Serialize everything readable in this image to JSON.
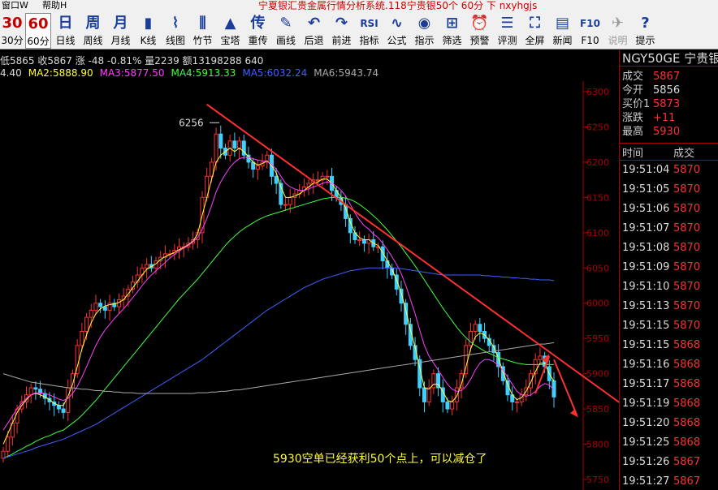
{
  "menu": {
    "window": "窗口W",
    "help": "帮助H"
  },
  "window_title": "宁夏银汇贵金属行情分析系统.118宁贵银50个 60分 下 nxyhgjs",
  "toolbar": [
    {
      "glyph": "30",
      "label": "30分",
      "disabled": false,
      "selected": false
    },
    {
      "glyph": "60",
      "label": "60分",
      "disabled": false,
      "selected": true
    },
    {
      "glyph": "日",
      "label": "日线",
      "disabled": false,
      "selected": false
    },
    {
      "glyph": "周",
      "label": "周线",
      "disabled": false,
      "selected": false
    },
    {
      "glyph": "月",
      "label": "月线",
      "disabled": false,
      "selected": false
    },
    {
      "glyph": "▮",
      "label": "K线",
      "disabled": false,
      "selected": false
    },
    {
      "glyph": "⌇",
      "label": "线图",
      "disabled": false,
      "selected": false
    },
    {
      "glyph": "⫼",
      "label": "竹节",
      "disabled": false,
      "selected": false
    },
    {
      "glyph": "▲",
      "label": "宝塔",
      "disabled": false,
      "selected": false
    },
    {
      "glyph": "传",
      "label": "重传",
      "disabled": false,
      "selected": false
    },
    {
      "glyph": "✎",
      "label": "画线",
      "disabled": false,
      "selected": false
    },
    {
      "glyph": "↶",
      "label": "后退",
      "disabled": false,
      "selected": false
    },
    {
      "glyph": "↷",
      "label": "前进",
      "disabled": false,
      "selected": false
    },
    {
      "glyph": "RSI",
      "label": "指标",
      "disabled": false,
      "selected": false
    },
    {
      "glyph": "∿",
      "label": "公式",
      "disabled": false,
      "selected": false
    },
    {
      "glyph": "◉",
      "label": "指示",
      "disabled": false,
      "selected": false
    },
    {
      "glyph": "⊞",
      "label": "筛选",
      "disabled": false,
      "selected": false
    },
    {
      "glyph": "⏰",
      "label": "预警",
      "disabled": false,
      "selected": false
    },
    {
      "glyph": "☰",
      "label": "评测",
      "disabled": false,
      "selected": false
    },
    {
      "glyph": "⛶",
      "label": "全屏",
      "disabled": false,
      "selected": false
    },
    {
      "glyph": "▤",
      "label": "新闻",
      "disabled": false,
      "selected": false
    },
    {
      "glyph": "F10",
      "label": "F10",
      "disabled": false,
      "selected": false
    },
    {
      "glyph": "✈",
      "label": "说明",
      "disabled": true,
      "selected": false
    },
    {
      "glyph": "?",
      "label": "提示",
      "disabled": false,
      "selected": false
    }
  ],
  "info_bar": "低5865 收5867 涨 -48 -0.81% 量2239 额13198288 640",
  "ma_values": [
    {
      "name": "MA1",
      "text": "4.40",
      "color": "#dddddd"
    },
    {
      "name": "MA2",
      "text": "MA2:5888.90",
      "color": "#ffff40"
    },
    {
      "name": "MA3",
      "text": "MA3:5877.50",
      "color": "#ff40ff"
    },
    {
      "name": "MA4",
      "text": "MA4:5913.33",
      "color": "#40ff40"
    },
    {
      "name": "MA5",
      "text": "MA5:6032.24",
      "color": "#4060ff"
    },
    {
      "name": "MA6",
      "text": "MA6:5943.74",
      "color": "#aaaaaa"
    }
  ],
  "right_panel": {
    "symbol": "NGY50GE 宁贵银",
    "quote": [
      {
        "key": "成交",
        "value": "5867"
      },
      {
        "key": "今开",
        "value": "5856",
        "neutral": true
      },
      {
        "key": "买价1",
        "value": "5873"
      },
      {
        "key": "涨跌",
        "value": "+11"
      },
      {
        "key": "最高",
        "value": "5930"
      }
    ],
    "tick_header": {
      "time": "时间",
      "price": "成交"
    },
    "ticks": [
      {
        "time": "19:51:04",
        "price": "5870"
      },
      {
        "time": "19:51:05",
        "price": "5870"
      },
      {
        "time": "19:51:06",
        "price": "5870"
      },
      {
        "time": "19:51:07",
        "price": "5870"
      },
      {
        "time": "19:51:08",
        "price": "5870"
      },
      {
        "time": "19:51:09",
        "price": "5870"
      },
      {
        "time": "19:51:10",
        "price": "5870"
      },
      {
        "time": "19:51:13",
        "price": "5870"
      },
      {
        "time": "19:51:15",
        "price": "5870"
      },
      {
        "time": "19:51:15",
        "price": "5868"
      },
      {
        "time": "19:51:16",
        "price": "5868"
      },
      {
        "time": "19:51:17",
        "price": "5868"
      },
      {
        "time": "19:51:19",
        "price": "5868"
      },
      {
        "time": "19:51:20",
        "price": "5868"
      },
      {
        "time": "19:51:25",
        "price": "5868"
      },
      {
        "time": "19:51:26",
        "price": "5867"
      },
      {
        "time": "19:51:27",
        "price": "5867"
      }
    ]
  },
  "colors": {
    "up": "#ff3030",
    "down": "#40d0ff",
    "axis": "#aa0000",
    "trend": "#ff3030"
  },
  "chart_data": {
    "type": "candlestick",
    "y_ticks": [
      6300,
      6250,
      6200,
      6150,
      6100,
      6050,
      6000,
      5950,
      5900,
      5850,
      5800,
      5750
    ],
    "ylim": [
      5735,
      6315
    ],
    "peak_label": "6256",
    "annotation": "5930空单已经获利50个点上，可以减仓了",
    "closes": [
      5790,
      5810,
      5830,
      5850,
      5860,
      5870,
      5880,
      5878,
      5872,
      5865,
      5860,
      5855,
      5850,
      5845,
      5880,
      5900,
      5940,
      5960,
      5980,
      5990,
      6000,
      5995,
      5990,
      6000,
      5995,
      6005,
      6010,
      6020,
      6030,
      6040,
      6050,
      6055,
      6050,
      6060,
      6065,
      6070,
      6070,
      6075,
      6080,
      6080,
      6085,
      6090,
      6100,
      6150,
      6180,
      6200,
      6240,
      6220,
      6210,
      6230,
      6220,
      6230,
      6210,
      6200,
      6190,
      6195,
      6200,
      6210,
      6180,
      6170,
      6140,
      6140,
      6150,
      6155,
      6160,
      6165,
      6170,
      6175,
      6175,
      6180,
      6180,
      6160,
      6150,
      6140,
      6120,
      6100,
      6090,
      6090,
      6085,
      6090,
      6080,
      6080,
      6060,
      6050,
      6040,
      6020,
      6000,
      5970,
      5940,
      5920,
      5880,
      5860,
      5880,
      5900,
      5880,
      5860,
      5850,
      5860,
      5880,
      5900,
      5940,
      5960,
      5970,
      5960,
      5950,
      5940,
      5930,
      5910,
      5890,
      5870,
      5860,
      5860,
      5870,
      5880,
      5900,
      5920,
      5925,
      5910,
      5890,
      5867
    ],
    "ma2": [
      5800,
      5815,
      5830,
      5845,
      5855,
      5863,
      5870,
      5872,
      5870,
      5867,
      5863,
      5858,
      5855,
      5855,
      5868,
      5885,
      5910,
      5935,
      5955,
      5972,
      5985,
      5992,
      5996,
      5998,
      5999,
      6001,
      6005,
      6013,
      6022,
      6031,
      6040,
      6048,
      6052,
      6056,
      6062,
      6066,
      6069,
      6072,
      6076,
      6079,
      6083,
      6088,
      6098,
      6125,
      6150,
      6175,
      6200,
      6210,
      6215,
      6220,
      6215,
      6220,
      6215,
      6208,
      6200,
      6196,
      6198,
      6202,
      6195,
      6185,
      6165,
      6150,
      6150,
      6152,
      6155,
      6160,
      6165,
      6170,
      6172,
      6176,
      6176,
      6170,
      6160,
      6150,
      6135,
      6115,
      6100,
      6093,
      6090,
      6090,
      6085,
      6082,
      6072,
      6060,
      6048,
      6033,
      6015,
      5990,
      5962,
      5938,
      5908,
      5880,
      5878,
      5885,
      5885,
      5875,
      5862,
      5860,
      5868,
      5885,
      5910,
      5935,
      5952,
      5958,
      5955,
      5948,
      5938,
      5922,
      5903,
      5885,
      5870,
      5863,
      5866,
      5875,
      5888,
      5903,
      5915,
      5915,
      5900,
      5889
    ],
    "ma3": [
      5820,
      5830,
      5840,
      5850,
      5858,
      5865,
      5870,
      5873,
      5873,
      5872,
      5870,
      5867,
      5864,
      5862,
      5865,
      5872,
      5882,
      5895,
      5910,
      5925,
      5940,
      5952,
      5962,
      5970,
      5978,
      5985,
      5992,
      6000,
      6008,
      6016,
      6025,
      6033,
      6040,
      6046,
      6052,
      6058,
      6064,
      6069,
      6074,
      6078,
      6082,
      6087,
      6093,
      6105,
      6120,
      6138,
      6158,
      6172,
      6183,
      6193,
      6200,
      6205,
      6207,
      6207,
      6205,
      6203,
      6202,
      6201,
      6197,
      6190,
      6180,
      6170,
      6165,
      6162,
      6160,
      6160,
      6162,
      6165,
      6167,
      6170,
      6172,
      6170,
      6166,
      6160,
      6152,
      6140,
      6128,
      6118,
      6110,
      6105,
      6098,
      6093,
      6085,
      6076,
      6066,
      6055,
      6042,
      6025,
      6005,
      5985,
      5962,
      5940,
      5925,
      5915,
      5905,
      5895,
      5885,
      5878,
      5875,
      5876,
      5882,
      5892,
      5905,
      5915,
      5920,
      5920,
      5917,
      5912,
      5905,
      5895,
      5885,
      5875,
      5870,
      5868,
      5870,
      5875,
      5882,
      5886,
      5884,
      5877
    ],
    "ma4": [
      5780,
      5783,
      5786,
      5790,
      5793,
      5797,
      5800,
      5804,
      5807,
      5810,
      5812,
      5815,
      5818,
      5820,
      5825,
      5830,
      5835,
      5841,
      5848,
      5855,
      5862,
      5870,
      5878,
      5886,
      5894,
      5902,
      5910,
      5918,
      5926,
      5934,
      5942,
      5950,
      5958,
      5966,
      5974,
      5982,
      5990,
      5998,
      6006,
      6013,
      6020,
      6027,
      6034,
      6042,
      6050,
      6058,
      6066,
      6074,
      6082,
      6089,
      6095,
      6101,
      6106,
      6110,
      6114,
      6118,
      6121,
      6124,
      6126,
      6128,
      6130,
      6132,
      6134,
      6136,
      6138,
      6140,
      6142,
      6144,
      6146,
      6148,
      6149,
      6150,
      6150,
      6150,
      6149,
      6147,
      6144,
      6140,
      6135,
      6130,
      6124,
      6118,
      6111,
      6104,
      6096,
      6088,
      6080,
      6071,
      6062,
      6053,
      6043,
      6033,
      6023,
      6013,
      6003,
      5993,
      5984,
      5975,
      5966,
      5958,
      5951,
      5945,
      5940,
      5936,
      5932,
      5929,
      5926,
      5923,
      5921,
      5919,
      5917,
      5915,
      5914,
      5913,
      5913,
      5913,
      5913,
      5913,
      5913,
      5913
    ],
    "ma5": [
      5780,
      5782,
      5784,
      5786,
      5788,
      5790,
      5792,
      5795,
      5797,
      5799,
      5801,
      5803,
      5805,
      5807,
      5810,
      5813,
      5816,
      5819,
      5822,
      5825,
      5828,
      5832,
      5836,
      5840,
      5844,
      5848,
      5852,
      5856,
      5860,
      5864,
      5868,
      5872,
      5876,
      5880,
      5884,
      5888,
      5892,
      5896,
      5900,
      5904,
      5908,
      5912,
      5916,
      5920,
      5925,
      5930,
      5935,
      5940,
      5945,
      5950,
      5955,
      5960,
      5965,
      5970,
      5975,
      5980,
      5985,
      5990,
      5994,
      5998,
      6002,
      6006,
      6010,
      6014,
      6018,
      6022,
      6025,
      6028,
      6031,
      6034,
      6036,
      6038,
      6040,
      6042,
      6044,
      6046,
      6047,
      6048,
      6049,
      6050,
      6050,
      6050,
      6050,
      6050,
      6050,
      6050,
      6049,
      6048,
      6047,
      6046,
      6045,
      6044,
      6043,
      6042,
      6041,
      6040,
      6040,
      6040,
      6040,
      6040,
      6040,
      6040,
      6040,
      6040,
      6039,
      6039,
      6038,
      6038,
      6037,
      6037,
      6036,
      6036,
      6035,
      6035,
      6034,
      6034,
      6033,
      6033,
      6033,
      6032
    ],
    "ma6": [
      5900,
      5898,
      5896,
      5894,
      5892,
      5890,
      5888,
      5887,
      5886,
      5885,
      5884,
      5883,
      5882,
      5881,
      5880,
      5880,
      5879,
      5878,
      5878,
      5877,
      5876,
      5876,
      5875,
      5875,
      5874,
      5874,
      5873,
      5873,
      5873,
      5872,
      5872,
      5872,
      5872,
      5872,
      5872,
      5872,
      5872,
      5872,
      5872,
      5872,
      5872,
      5872,
      5873,
      5873,
      5873,
      5874,
      5874,
      5875,
      5875,
      5876,
      5877,
      5877,
      5878,
      5879,
      5880,
      5881,
      5882,
      5883,
      5884,
      5885,
      5886,
      5887,
      5888,
      5889,
      5890,
      5891,
      5892,
      5893,
      5894,
      5895,
      5896,
      5897,
      5898,
      5899,
      5900,
      5901,
      5902,
      5903,
      5904,
      5905,
      5906,
      5907,
      5908,
      5909,
      5910,
      5911,
      5912,
      5913,
      5914,
      5915,
      5916,
      5917,
      5918,
      5919,
      5920,
      5921,
      5922,
      5923,
      5924,
      5925,
      5926,
      5927,
      5928,
      5929,
      5930,
      5931,
      5932,
      5933,
      5934,
      5935,
      5936,
      5937,
      5938,
      5939,
      5940,
      5941,
      5942,
      5942,
      5943,
      5944
    ]
  }
}
